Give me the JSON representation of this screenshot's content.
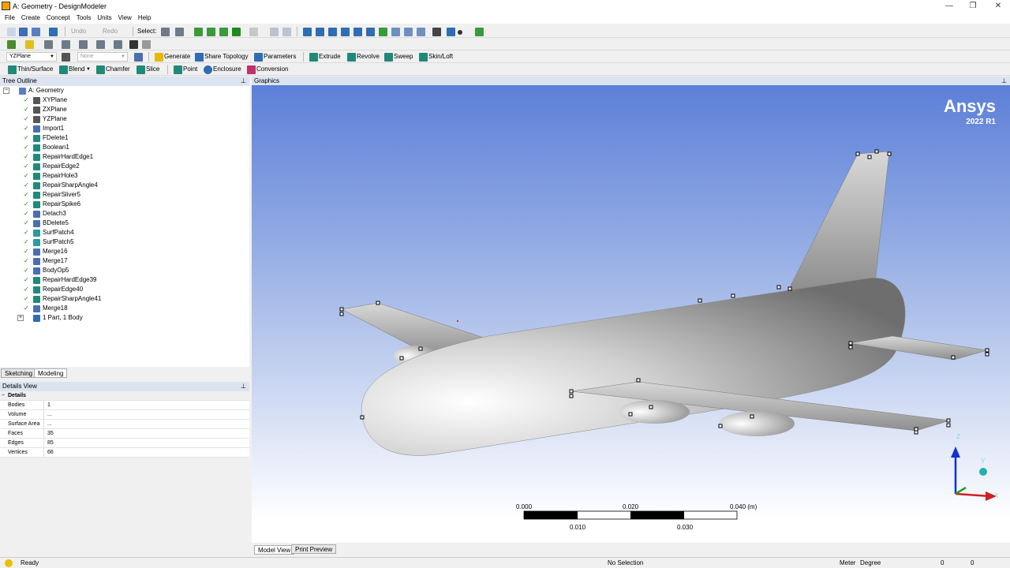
{
  "window": {
    "title": "A: Geometry - DesignModeler",
    "min": "—",
    "max": "❐",
    "close": "✕"
  },
  "menu": [
    "File",
    "Create",
    "Concept",
    "Tools",
    "Units",
    "View",
    "Help"
  ],
  "toolbar1": {
    "undo": "Undo",
    "redo": "Redo",
    "select": "Select:"
  },
  "toolbar3": {
    "plane_combo": "YZPlane",
    "sketch_combo": "None",
    "generate": "Generate",
    "share_topology": "Share Topology",
    "parameters": "Parameters",
    "extrude": "Extrude",
    "revolve": "Revolve",
    "sweep": "Sweep",
    "skin_loft": "Skin/Loft"
  },
  "toolbar4": {
    "thin_surface": "Thin/Surface",
    "blend": "Blend",
    "chamfer": "Chamfer",
    "slice": "Slice",
    "point": "Point",
    "enclosure": "Enclosure",
    "conversion": "Conversion"
  },
  "tree": {
    "header": "Tree Outline",
    "root": "A: Geometry",
    "items": [
      "XYPlane",
      "ZXPlane",
      "YZPlane",
      "Import1",
      "FDelete1",
      "Boolean1",
      "RepairHardEdge1",
      "RepairEdge2",
      "RepairHole3",
      "RepairSharpAngle4",
      "RepairSliver5",
      "RepairSpike6",
      "Detach3",
      "BDelete5",
      "SurfPatch4",
      "SurfPatch5",
      "Merge16",
      "Merge17",
      "BodyOp5",
      "RepairHardEdge39",
      "RepairEdge40",
      "RepairSharpAngle41",
      "Merge18"
    ],
    "last": "1 Part, 1 Body"
  },
  "tabs": {
    "sketching": "Sketching",
    "modeling": "Modeling"
  },
  "details": {
    "header": "Details View",
    "section": "Details",
    "rows": [
      {
        "k": "Bodies",
        "v": "1"
      },
      {
        "k": "Volume",
        "v": "..."
      },
      {
        "k": "Surface Area",
        "v": "..."
      },
      {
        "k": "Faces",
        "v": "35"
      },
      {
        "k": "Edges",
        "v": "85"
      },
      {
        "k": "Vertices",
        "v": "66"
      }
    ]
  },
  "graphics": {
    "header": "Graphics",
    "brand": "Ansys",
    "version": "2022 R1",
    "scale_top": [
      "0.000",
      "0.020",
      "0.040 (m)"
    ],
    "scale_bottom": [
      "0.010",
      "0.030"
    ],
    "axis_z": "Z",
    "axis_y": "Y",
    "axis_x": "X"
  },
  "viewtabs": {
    "model": "Model View",
    "print": "Print Preview"
  },
  "status": {
    "ready": "Ready",
    "selection": "No Selection",
    "units": "Meter",
    "angle": "Degree",
    "v1": "0",
    "v2": "0"
  }
}
